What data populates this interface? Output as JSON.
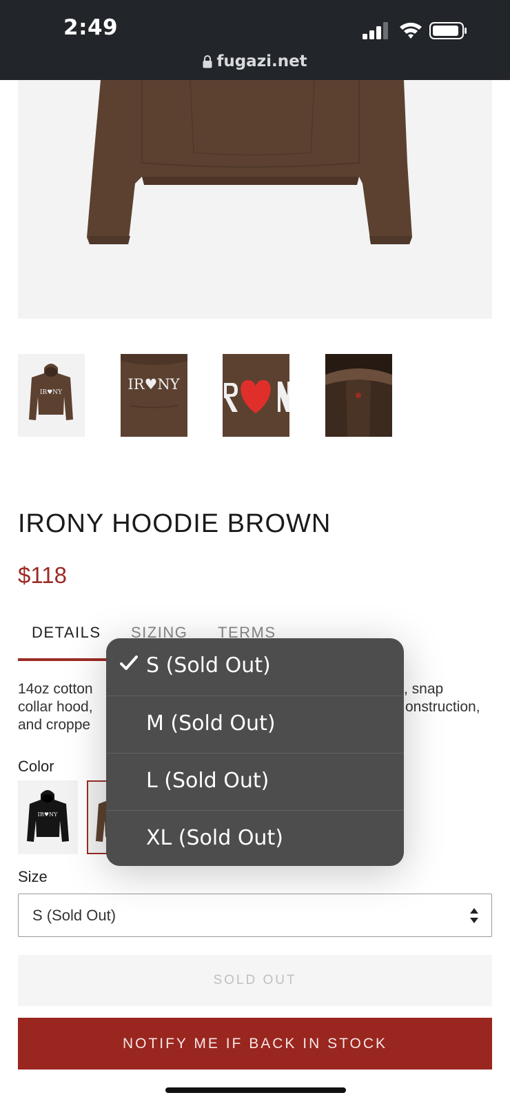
{
  "status_bar": {
    "time": "2:49",
    "url": "fugazi.net",
    "icons": [
      "signal-icon",
      "wifi-icon",
      "battery-icon",
      "lock-icon"
    ]
  },
  "product": {
    "title": "IRONY HOODIE BROWN",
    "price": "$118",
    "thumbnail_texts": [
      "IR♥NY",
      "IR♥NY",
      "R♥N"
    ]
  },
  "tabs": [
    {
      "label": "DETAILS",
      "active": true
    },
    {
      "label": "SIZING",
      "active": false
    },
    {
      "label": "TERMS",
      "active": false
    }
  ],
  "description": {
    "left_lines": [
      "14oz cotton",
      "collar hood,",
      "and croppe"
    ],
    "right_lines": [
      ", snap",
      "onstruction,",
      ""
    ]
  },
  "color": {
    "label": "Color",
    "swatch_text": "IR♥NY",
    "selected_index": 1
  },
  "size": {
    "label": "Size",
    "selected": "S (Sold Out)",
    "options": [
      "S (Sold Out)",
      "M (Sold Out)",
      "L (Sold Out)",
      "XL (Sold Out)"
    ],
    "checked_index": 0
  },
  "buttons": {
    "sold_out": "SOLD OUT",
    "notify": "NOTIFY ME IF BACK IN STOCK"
  },
  "colors": {
    "accent": "#9b2b25",
    "notify_bg": "#99261f",
    "status_bar": "#22252a",
    "hoodie_brown": "#5c4130",
    "picker_bg": "#4d4d4d"
  }
}
